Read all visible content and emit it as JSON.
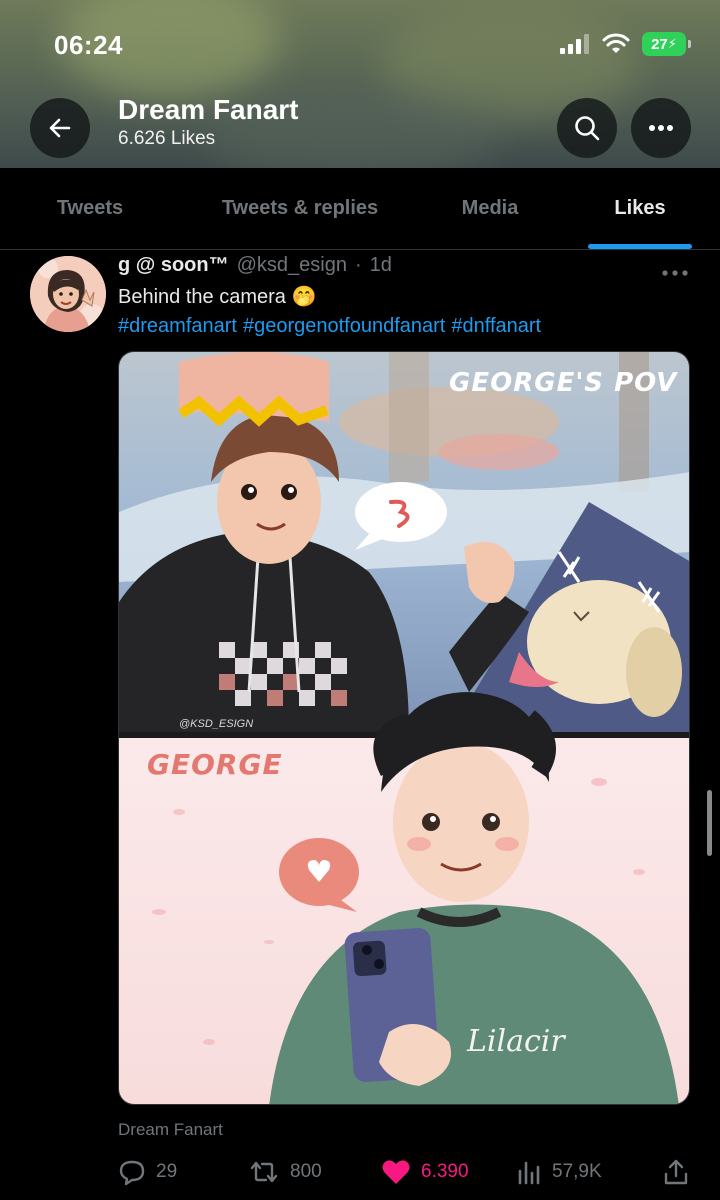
{
  "status_bar": {
    "time": "06:24",
    "battery": "27"
  },
  "header": {
    "title": "Dream Fanart",
    "subtitle": "6.626 Likes"
  },
  "tabs": [
    {
      "label": "Tweets",
      "active": false
    },
    {
      "label": "Tweets & replies",
      "active": false
    },
    {
      "label": "Media",
      "active": false
    },
    {
      "label": "Likes",
      "active": true
    }
  ],
  "tweet": {
    "name": "g @ soon™",
    "handle": "@ksd_esign",
    "separator": "·",
    "age": "1d",
    "text": "Behind the camera 🤭",
    "hashtags": [
      "#dreamfanart",
      "#georgenotfoundfanart",
      "#dnffanart"
    ],
    "image_texts": {
      "top_caption": "GEORGE'S POV",
      "bottom_caption": "GEORGE",
      "signature": "@KSD_ESIGN",
      "sweater_text": "Lilacir"
    },
    "source": "Dream Fanart",
    "actions": {
      "replies": "29",
      "retweets": "800",
      "likes": "6.390",
      "views": "57,9K"
    }
  },
  "colors": {
    "accent": "#1d9bf0",
    "like": "#f91880",
    "muted": "#71767b"
  }
}
